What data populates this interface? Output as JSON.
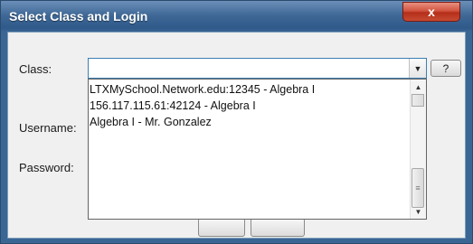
{
  "window": {
    "title": "Select Class and Login",
    "close_label": "x"
  },
  "labels": {
    "class": "Class:",
    "username": "Username:",
    "password": "Password:"
  },
  "class_combo": {
    "value": ""
  },
  "help_button": {
    "label": "?"
  },
  "class_options": [
    "LTXMySchool.Network.edu:12345 - Algebra I",
    "156.117.115.61:42124 - Algebra I",
    "Algebra I - Mr. Gonzalez"
  ]
}
